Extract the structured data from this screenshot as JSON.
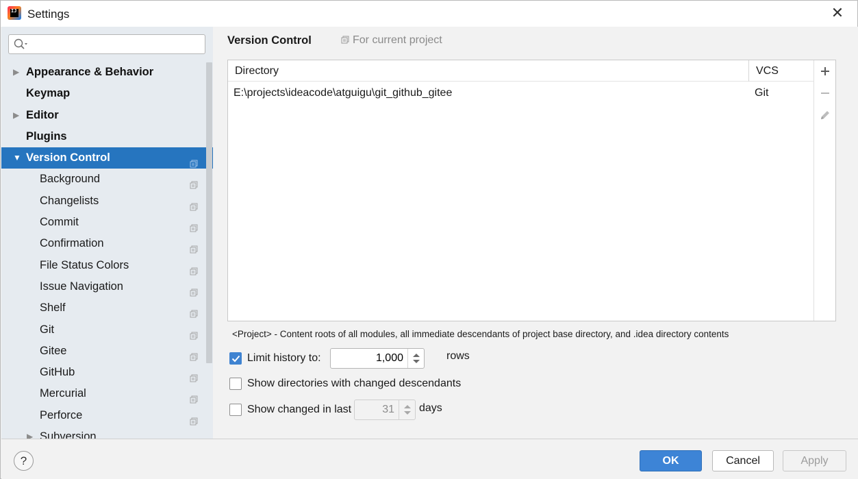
{
  "window": {
    "title": "Settings",
    "app_icon_text": "IJ",
    "close_glyph": "✕"
  },
  "search": {
    "value": "",
    "placeholder": ""
  },
  "sidebar": {
    "items": [
      {
        "label": "Appearance & Behavior",
        "level": 0,
        "arrow": "▶",
        "project": false
      },
      {
        "label": "Keymap",
        "level": 0,
        "arrow": "",
        "project": false
      },
      {
        "label": "Editor",
        "level": 0,
        "arrow": "▶",
        "project": false
      },
      {
        "label": "Plugins",
        "level": 0,
        "arrow": "",
        "project": false
      },
      {
        "label": "Version Control",
        "level": 0,
        "arrow": "▼",
        "project": true,
        "selected": true
      },
      {
        "label": "Background",
        "level": 1,
        "project": true
      },
      {
        "label": "Changelists",
        "level": 1,
        "project": true
      },
      {
        "label": "Commit",
        "level": 1,
        "project": true
      },
      {
        "label": "Confirmation",
        "level": 1,
        "project": true
      },
      {
        "label": "File Status Colors",
        "level": 1,
        "project": true
      },
      {
        "label": "Issue Navigation",
        "level": 1,
        "project": true
      },
      {
        "label": "Shelf",
        "level": 1,
        "project": true
      },
      {
        "label": "Git",
        "level": 1,
        "project": true
      },
      {
        "label": "Gitee",
        "level": 1,
        "project": true
      },
      {
        "label": "GitHub",
        "level": 1,
        "project": true
      },
      {
        "label": "Mercurial",
        "level": 1,
        "project": true
      },
      {
        "label": "Perforce",
        "level": 1,
        "project": true
      },
      {
        "label": "Subversion",
        "level": 1,
        "project": true,
        "arrow": "▶"
      }
    ]
  },
  "content": {
    "title": "Version Control",
    "scope_label": "For current project",
    "table": {
      "headers": {
        "directory": "Directory",
        "vcs": "VCS"
      },
      "rows": [
        {
          "directory": "E:\\projects\\ideacode\\atguigu\\git_github_gitee",
          "vcs": "Git"
        }
      ],
      "toolbar": {
        "add": "+",
        "remove": "−"
      }
    },
    "hint": "<Project> - Content roots of all modules, all immediate descendants of project base directory, and .idea directory contents",
    "options": {
      "limit_history": {
        "label": "Limit history to:",
        "checked": true,
        "value": "1,000",
        "suffix": "rows"
      },
      "show_dirs": {
        "label": "Show directories with changed descendants",
        "checked": false
      },
      "show_changed": {
        "label": "Show changed in last",
        "checked": false,
        "value": "31",
        "suffix": "days"
      }
    }
  },
  "footer": {
    "help": "?",
    "ok": "OK",
    "cancel": "Cancel",
    "apply": "Apply"
  },
  "colors": {
    "selection": "#2675bf",
    "primary_button": "#3d84d6",
    "checkbox_checked": "#3f83d1",
    "sidebar_bg": "#e6ebf0"
  }
}
